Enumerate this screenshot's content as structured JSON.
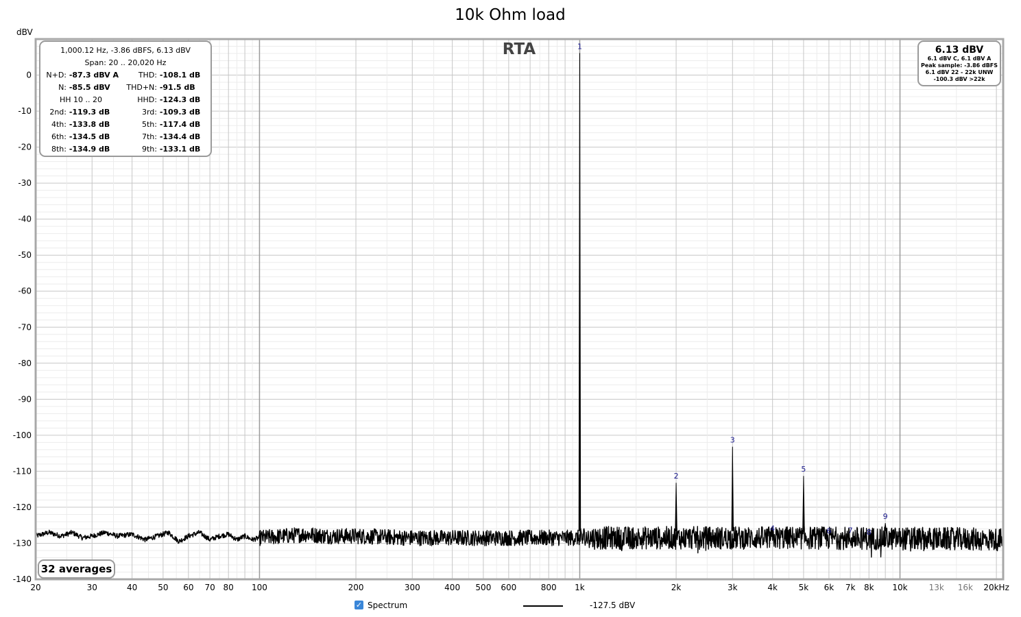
{
  "chart_data": {
    "type": "line",
    "title": "10k Ohm load",
    "ylabel": "dBV",
    "xlabel": "",
    "x_scale": "log",
    "xlim": [
      20,
      21000
    ],
    "ylim": [
      -140,
      10
    ],
    "x_ticks": [
      {
        "v": 20,
        "label": "20"
      },
      {
        "v": 30,
        "label": "30"
      },
      {
        "v": 40,
        "label": "40"
      },
      {
        "v": 50,
        "label": "50"
      },
      {
        "v": 60,
        "label": "60"
      },
      {
        "v": 70,
        "label": "70"
      },
      {
        "v": 80,
        "label": "80"
      },
      {
        "v": 100,
        "label": "100"
      },
      {
        "v": 200,
        "label": "200"
      },
      {
        "v": 300,
        "label": "300"
      },
      {
        "v": 400,
        "label": "400"
      },
      {
        "v": 500,
        "label": "500"
      },
      {
        "v": 600,
        "label": "600"
      },
      {
        "v": 800,
        "label": "800"
      },
      {
        "v": 1000,
        "label": "1k"
      },
      {
        "v": 2000,
        "label": "2k"
      },
      {
        "v": 3000,
        "label": "3k"
      },
      {
        "v": 4000,
        "label": "4k"
      },
      {
        "v": 5000,
        "label": "5k"
      },
      {
        "v": 6000,
        "label": "6k"
      },
      {
        "v": 7000,
        "label": "7k"
      },
      {
        "v": 8000,
        "label": "8k"
      },
      {
        "v": 10000,
        "label": "10k"
      },
      {
        "v": 13000,
        "label": "13k"
      },
      {
        "v": 16000,
        "label": "16k"
      },
      {
        "v": 20000,
        "label": "20kHz"
      }
    ],
    "y_ticks": [
      0,
      -10,
      -20,
      -30,
      -40,
      -50,
      -60,
      -70,
      -80,
      -90,
      -100,
      -110,
      -120,
      -130,
      -140
    ],
    "grid": true,
    "overlay_label": "RTA",
    "series": [
      {
        "name": "Spectrum",
        "color": "#000000",
        "noise_floor_dbv": -128.5,
        "points": [
          [
            20,
            -128
          ],
          [
            22,
            -127
          ],
          [
            24,
            -128
          ],
          [
            26,
            -127
          ],
          [
            28,
            -128.5
          ],
          [
            30,
            -128
          ],
          [
            33,
            -127
          ],
          [
            36,
            -128
          ],
          [
            40,
            -127.5
          ],
          [
            44,
            -129
          ],
          [
            48,
            -128
          ],
          [
            52,
            -127
          ],
          [
            56,
            -129.5
          ],
          [
            60,
            -128
          ],
          [
            65,
            -127
          ],
          [
            70,
            -129
          ],
          [
            75,
            -128
          ],
          [
            80,
            -127.5
          ],
          [
            85,
            -129
          ],
          [
            90,
            -128
          ],
          [
            95,
            -129
          ],
          [
            100,
            -128.5
          ],
          [
            120,
            -128
          ],
          [
            140,
            -127.5
          ],
          [
            160,
            -128
          ],
          [
            200,
            -128
          ],
          [
            300,
            -128.5
          ],
          [
            500,
            -128.5
          ],
          [
            800,
            -128.5
          ],
          [
            1000,
            -128.5
          ],
          [
            2000,
            -128.5
          ],
          [
            5000,
            -128.5
          ],
          [
            10000,
            -128.7
          ],
          [
            15000,
            -128.8
          ],
          [
            21000,
            -129
          ]
        ],
        "peaks": [
          {
            "label": "1",
            "f": 1000,
            "dbv": 6.13
          },
          {
            "label": "2",
            "f": 2000,
            "dbv": -113.2
          },
          {
            "label": "3",
            "f": 3000,
            "dbv": -103.2
          },
          {
            "label": "4",
            "f": 4000,
            "dbv": -127.7
          },
          {
            "label": "5",
            "f": 5000,
            "dbv": -111.3
          },
          {
            "label": "6",
            "f": 6000,
            "dbv": -128.4
          },
          {
            "label": "7",
            "f": 7000,
            "dbv": -128.3
          },
          {
            "label": "8",
            "f": 8000,
            "dbv": -128.8
          },
          {
            "label": "9",
            "f": 9000,
            "dbv": -124.4
          }
        ]
      }
    ],
    "legend": {
      "placement": "bottom",
      "entries": [
        {
          "name": "Spectrum",
          "value": "-127.5 dBV",
          "checked": true
        }
      ]
    }
  },
  "stats": {
    "header": "1,000.12 Hz, -3.86 dBFS, 6.13 dBV",
    "span": "Span: 20 .. 20,020 Hz",
    "rows": [
      [
        {
          "label": "N+D:",
          "value": "-87.3 dBV A"
        },
        {
          "label": "THD:",
          "value": "-108.1 dB"
        }
      ],
      [
        {
          "label": "N:",
          "value": "-85.5 dBV"
        },
        {
          "label": "THD+N:",
          "value": "-91.5 dB"
        }
      ],
      [
        {
          "label": "HH 10 .. 20",
          "value": ""
        },
        {
          "label": "HHD:",
          "value": "-124.3 dB"
        }
      ],
      [
        {
          "label": "2nd:",
          "value": "-119.3 dB"
        },
        {
          "label": "3rd:",
          "value": "-109.3 dB"
        }
      ],
      [
        {
          "label": "4th:",
          "value": "-133.8 dB"
        },
        {
          "label": "5th:",
          "value": "-117.4 dB"
        }
      ],
      [
        {
          "label": "6th:",
          "value": "-134.5 dB"
        },
        {
          "label": "7th:",
          "value": "-134.4 dB"
        }
      ],
      [
        {
          "label": "8th:",
          "value": "-134.9 dB"
        },
        {
          "label": "9th:",
          "value": "-133.1 dB"
        }
      ]
    ]
  },
  "level": {
    "main": "6.13 dBV",
    "lines": [
      "6.1 dBV C, 6.1 dBV A",
      "Peak sample: -3.86 dBFS",
      "6.1 dBV 22 - 22k UNW",
      "-100.3 dBV >22k"
    ]
  },
  "averages": "32 averages",
  "colors": {
    "plot_border": "#a8a8a8",
    "grid_major": "#c6c6c6",
    "grid_minor": "#ececec",
    "decade_line": "#9a9a9a",
    "peak_label": "#1a1a8c",
    "trace": "#000000"
  }
}
